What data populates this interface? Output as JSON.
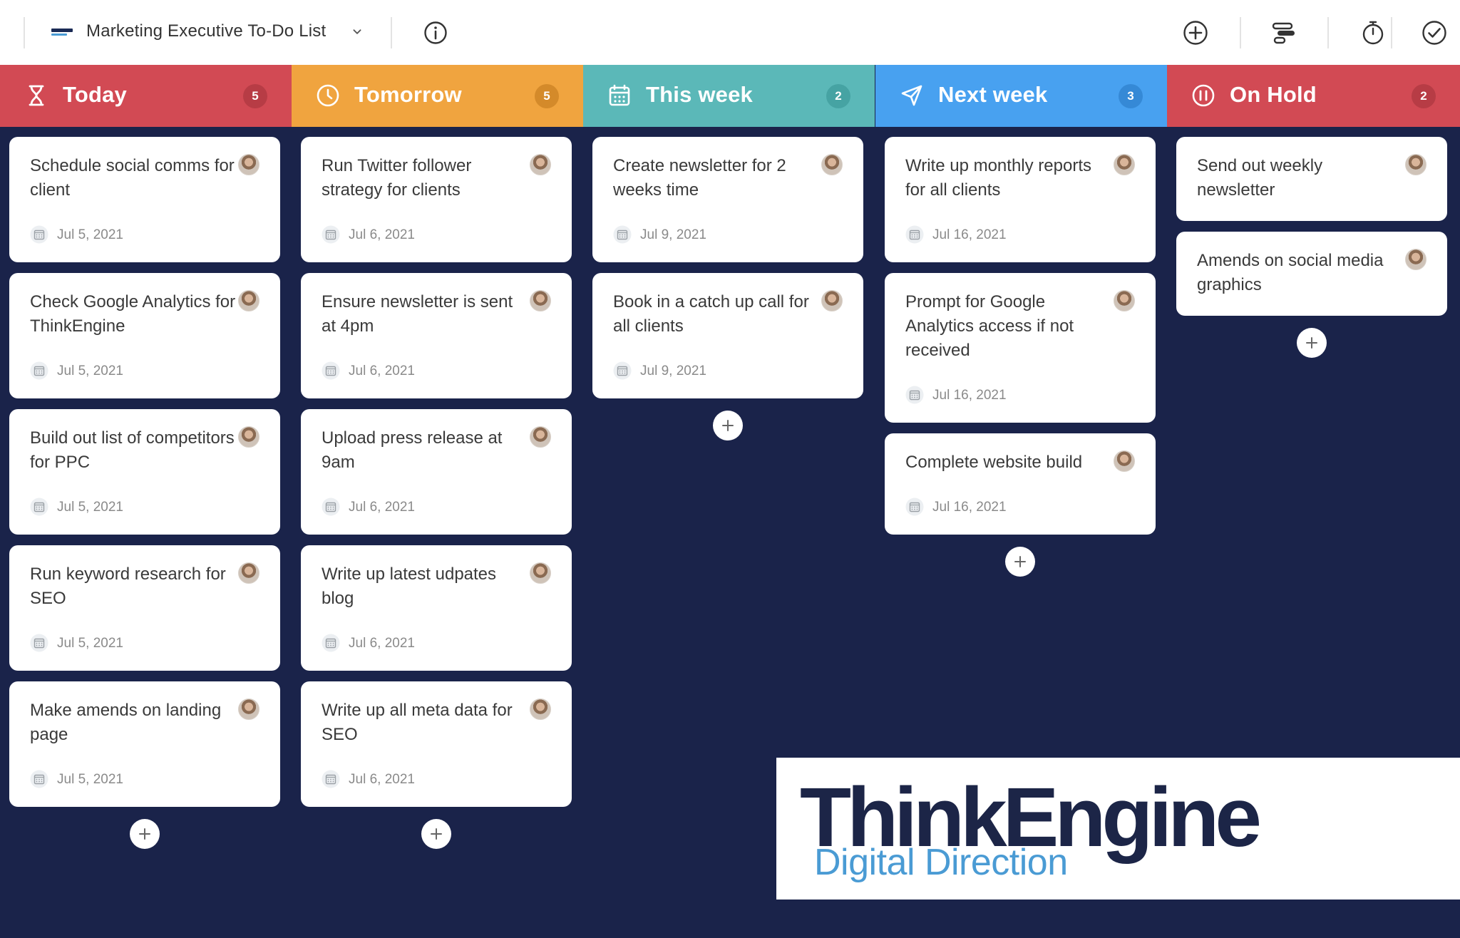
{
  "header": {
    "title": "Marketing Executive To-Do List",
    "colors": {
      "background": "#ffffff",
      "text": "#333333",
      "icon": "#333333"
    },
    "icons": [
      "board-logo-icon",
      "chevron-down-icon",
      "info-icon",
      "add-circle-icon",
      "timeline-icon",
      "stopwatch-icon",
      "check-circle-icon"
    ]
  },
  "colors": {
    "board_background": "#1a234a",
    "card_background": "#ffffff"
  },
  "columns": [
    {
      "title": "Today",
      "count": "5",
      "icon": "hourglass-icon",
      "color": "#d24a54",
      "badge_color": "#b73c45",
      "cards": [
        {
          "text": "Schedule social comms for client",
          "date": "Jul 5, 2021"
        },
        {
          "text": "Check Google Analytics for ThinkEngine",
          "date": "Jul 5, 2021"
        },
        {
          "text": "Build out list of competitors for PPC",
          "date": "Jul 5, 2021"
        },
        {
          "text": "Run keyword research for SEO",
          "date": "Jul 5, 2021"
        },
        {
          "text": "Make amends on landing page",
          "date": "Jul 5, 2021"
        }
      ]
    },
    {
      "title": "Tomorrow",
      "count": "5",
      "icon": "clock-icon",
      "color": "#f0a43f",
      "badge_color": "#d48a2a",
      "cards": [
        {
          "text": "Run Twitter follower strategy for clients",
          "date": "Jul 6, 2021"
        },
        {
          "text": "Ensure newsletter is sent at 4pm",
          "date": "Jul 6, 2021"
        },
        {
          "text": "Upload press release at 9am",
          "date": "Jul 6, 2021"
        },
        {
          "text": "Write up latest udpates blog",
          "date": "Jul 6, 2021"
        },
        {
          "text": "Write up all meta data for SEO",
          "date": "Jul 6, 2021"
        }
      ]
    },
    {
      "title": "This week",
      "count": "2",
      "icon": "calendar-icon",
      "color": "#5bb8b8",
      "badge_color": "#46a3a3",
      "cards": [
        {
          "text": "Create newsletter for 2 weeks time",
          "date": "Jul 9, 2021"
        },
        {
          "text": "Book in a catch up call for all clients",
          "date": "Jul 9, 2021"
        }
      ]
    },
    {
      "title": "Next week",
      "count": "3",
      "icon": "airplane-icon",
      "color": "#48a1f0",
      "badge_color": "#3589d6",
      "cards": [
        {
          "text": "Write up monthly reports for all clients",
          "date": "Jul 16, 2021"
        },
        {
          "text": "Prompt for Google Analytics access if not received",
          "date": "Jul 16, 2021"
        },
        {
          "text": "Complete website build",
          "date": "Jul 16, 2021"
        }
      ]
    },
    {
      "title": "On Hold",
      "count": "2",
      "icon": "pause-circle-icon",
      "color": "#d24a54",
      "badge_color": "#b73c45",
      "cards": [
        {
          "text": "Send out weekly newsletter",
          "date": ""
        },
        {
          "text": "Amends on social media graphics",
          "date": ""
        }
      ]
    }
  ],
  "logo": {
    "main": "ThinkEngine",
    "sub": "Digital Direction"
  }
}
